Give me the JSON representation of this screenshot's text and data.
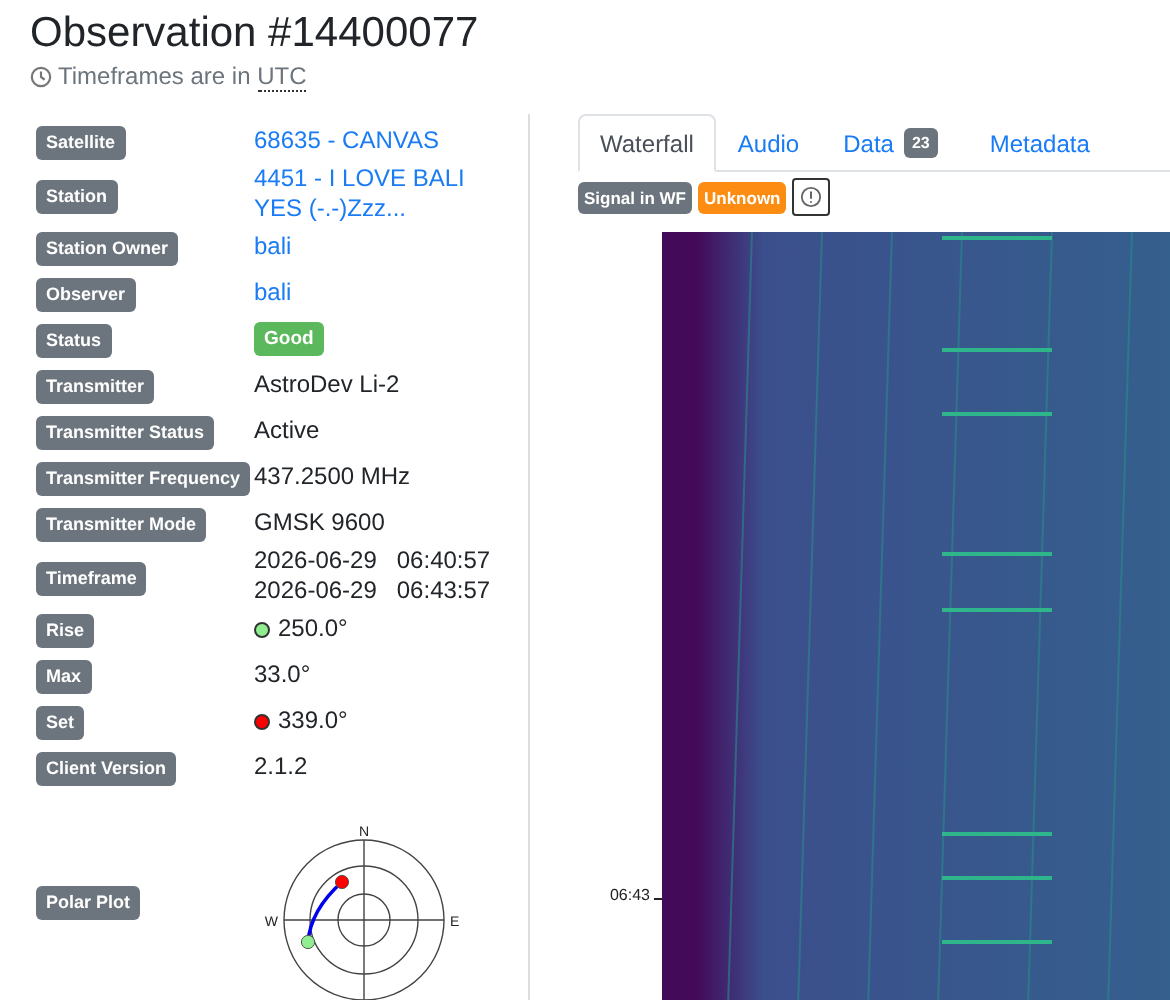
{
  "title": "Observation #14400077",
  "subtitle": {
    "text": "Timeframes are in ",
    "abbr": "UTC"
  },
  "details": [
    {
      "label": "Satellite",
      "kind": "link",
      "lines": [
        "68635 - CANVAS"
      ]
    },
    {
      "label": "Station",
      "kind": "link",
      "lines": [
        "4451 - I LOVE BALI",
        "YES (-.-)Zzz..."
      ]
    },
    {
      "label": "Station Owner",
      "kind": "link",
      "lines": [
        "bali"
      ]
    },
    {
      "label": "Observer",
      "kind": "link",
      "lines": [
        "bali"
      ]
    },
    {
      "label": "Status",
      "kind": "badge",
      "lines": [
        "Good"
      ],
      "color": "#5cb85c"
    },
    {
      "label": "Transmitter",
      "kind": "text",
      "lines": [
        "AstroDev Li-2"
      ]
    },
    {
      "label": "Transmitter Status",
      "kind": "text",
      "lines": [
        "Active"
      ]
    },
    {
      "label": "Transmitter Frequency",
      "kind": "text",
      "lines": [
        "437.2500 MHz"
      ]
    },
    {
      "label": "Transmitter Mode",
      "kind": "text",
      "lines": [
        "GMSK 9600"
      ]
    },
    {
      "label": "Timeframe",
      "kind": "text",
      "lines": [
        "2026-06-29   06:40:57",
        "2026-06-29   06:43:57"
      ]
    },
    {
      "label": "Rise",
      "kind": "dot",
      "lines": [
        "250.0°"
      ],
      "color": "#90ee90"
    },
    {
      "label": "Max",
      "kind": "text",
      "lines": [
        "33.0°"
      ]
    },
    {
      "label": "Set",
      "kind": "dot",
      "lines": [
        "339.0°"
      ],
      "color": "#ff0000"
    },
    {
      "label": "Client Version",
      "kind": "text",
      "lines": [
        "2.1.2"
      ]
    },
    {
      "label": "Polar Plot",
      "kind": "plot",
      "lines": [
        "N",
        "W",
        "E"
      ]
    }
  ],
  "tabs": [
    {
      "label": "Waterfall",
      "selected": true
    },
    {
      "label": "Audio",
      "selected": false
    },
    {
      "label": "Data",
      "selected": false,
      "count": "23"
    },
    {
      "label": "Metadata",
      "selected": false
    }
  ],
  "waterfall": {
    "tags": [
      {
        "text": "Signal in WF",
        "color": "#6c757d"
      },
      {
        "text": "Unknown",
        "color": "#fd8c12"
      }
    ],
    "axis_label": "06:43"
  }
}
